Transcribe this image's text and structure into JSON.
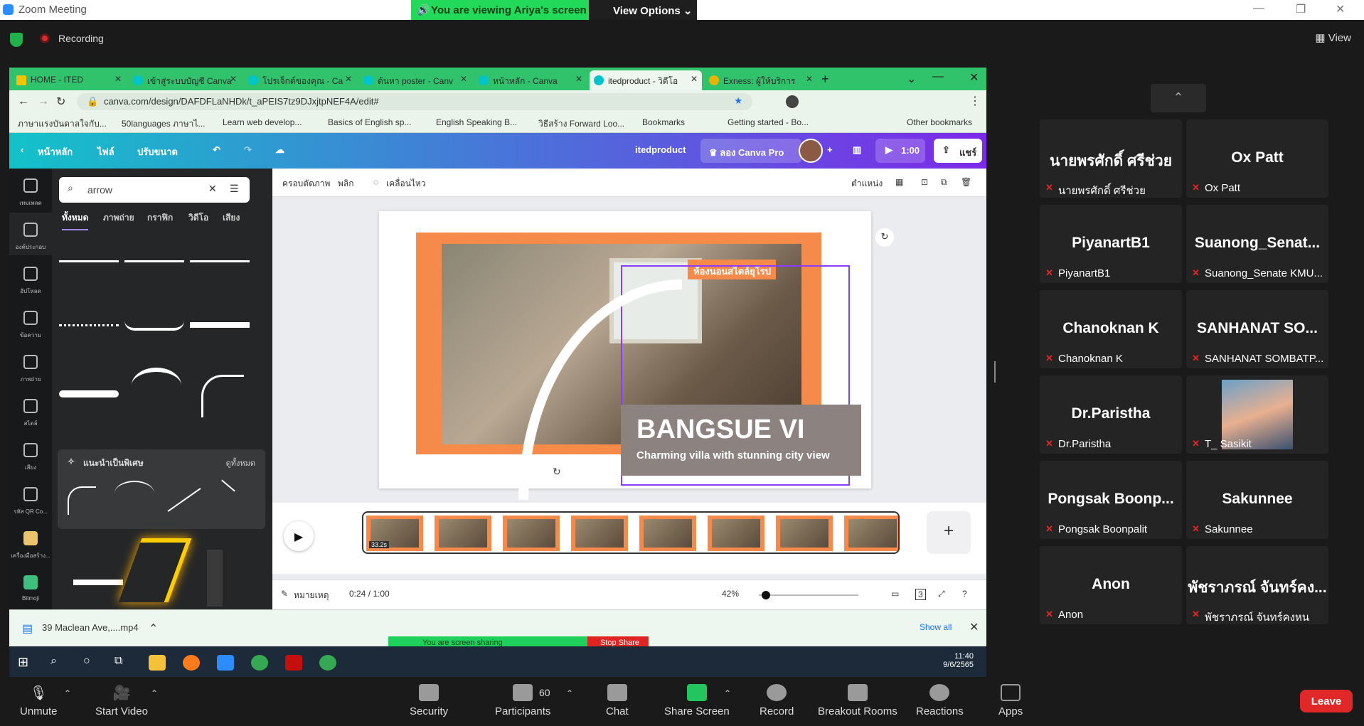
{
  "zoom": {
    "window_title": "Zoom Meeting",
    "viewing_banner": "You are viewing Ariya's screen",
    "view_options": "View Options",
    "recording": "Recording",
    "view": "View",
    "leave": "Leave",
    "controls": [
      {
        "label": "Unmute",
        "icon": "mic-muted-icon"
      },
      {
        "label": "Start Video",
        "icon": "video-off-icon"
      },
      {
        "label": "Security",
        "icon": "shield-icon"
      },
      {
        "label": "Participants",
        "icon": "participants-icon",
        "count": "60"
      },
      {
        "label": "Chat",
        "icon": "chat-icon"
      },
      {
        "label": "Share Screen",
        "icon": "share-screen-icon"
      },
      {
        "label": "Record",
        "icon": "record-icon"
      },
      {
        "label": "Breakout Rooms",
        "icon": "breakout-rooms-icon"
      },
      {
        "label": "Reactions",
        "icon": "reactions-icon"
      },
      {
        "label": "Apps",
        "icon": "apps-icon"
      }
    ],
    "participants": [
      {
        "display": "นายพรศักดิ์ ศรีช่วย",
        "label": "นายพรศักดิ์ ศรีช่วย"
      },
      {
        "display": "Ox Patt",
        "label": "Ox Patt"
      },
      {
        "display": "PiyanartB1",
        "label": "PiyanartB1"
      },
      {
        "display": "Suanong_Senat...",
        "label": "Suanong_Senate KMU..."
      },
      {
        "display": "Chanoknan K",
        "label": "Chanoknan K"
      },
      {
        "display": "SANHANAT SO...",
        "label": "SANHANAT SOMBATP..."
      },
      {
        "display": "Dr.Paristha",
        "label": "Dr.Paristha"
      },
      {
        "display": "",
        "label": "T_ Sasikit"
      },
      {
        "display": "Pongsak Boonp...",
        "label": "Pongsak Boonpalit"
      },
      {
        "display": "Sakunnee",
        "label": "Sakunnee"
      },
      {
        "display": "Anon",
        "label": "Anon"
      },
      {
        "display": "พัชราภรณ์ จันทร์คง...",
        "label": "พัชราภรณ์ จันทร์คงหน"
      }
    ]
  },
  "browser": {
    "tabs": [
      "HOME - ITED",
      "เข้าสู่ระบบบัญชี Canva",
      "โปรเจ็กต์ของคุณ - Ca",
      "ต้นหา poster - Canv",
      "หน้าหลัก - Canva",
      "itedproduct - วิดีโอ",
      "Exness: ผู้ให้บริการ"
    ],
    "url": "canva.com/design/DAFDFLaNHDk/t_aPEIS7tz9DJxjtpNEF4A/edit#",
    "bookmarks": [
      "ภาษาแรงบันดาลใจกับ...",
      "50languages ภาษาไ...",
      "Learn web develop...",
      "Basics of English sp...",
      "English Speaking B...",
      "วิธีสร้าง Forward Loo...",
      "Bookmarks",
      "Getting started - Bo...",
      "Other bookmarks"
    ]
  },
  "canva": {
    "nav": [
      "หน้าหลัก",
      "ไฟล์",
      "ปรับขนาด"
    ],
    "project": "itedproduct",
    "try_pro": "ลอง Canva Pro",
    "play": "1:00",
    "share": "แชร์",
    "rail": [
      "เทมเพลต",
      "องค์ประกอบ",
      "อัปโหลด",
      "ข้อความ",
      "ภาพถ่าย",
      "สไตล์",
      "เสียง",
      "รหัส QR Co...",
      "เครื่องมือสร้าง...",
      "Bitmoji"
    ],
    "search_value": "arrow",
    "panel_tabs": [
      "ทั้งหมด",
      "ภาพถ่าย",
      "กราฟิก",
      "วิดีโอ",
      "เสียง"
    ],
    "suggest_title": "แนะนำเป็นพิเศษ",
    "suggest_all": "ดูทั้งหมด",
    "toolbar": [
      "ครอบตัดภาพ",
      "พลิก",
      "เคลื่อนไหว"
    ],
    "position": "ตำแหน่ง",
    "slide": {
      "badge": "ห้องนอนสไตล์ยุโรป",
      "title": "BANGSUE VI",
      "subtitle": "Charming villa with stunning city view"
    },
    "notes": "หมายเหตุ",
    "time": "0:24 / 1:00",
    "zoom_level": "42%",
    "page_count": "3",
    "thumb_time": "33.2s"
  },
  "downloads": {
    "file": "39 Maclean Ave,....mp4",
    "show_all": "Show all"
  },
  "sharing": {
    "banner": "You are screen sharing",
    "stop": "Stop Share"
  },
  "taskbar": {
    "time": "11:40",
    "date": "9/6/2565"
  }
}
